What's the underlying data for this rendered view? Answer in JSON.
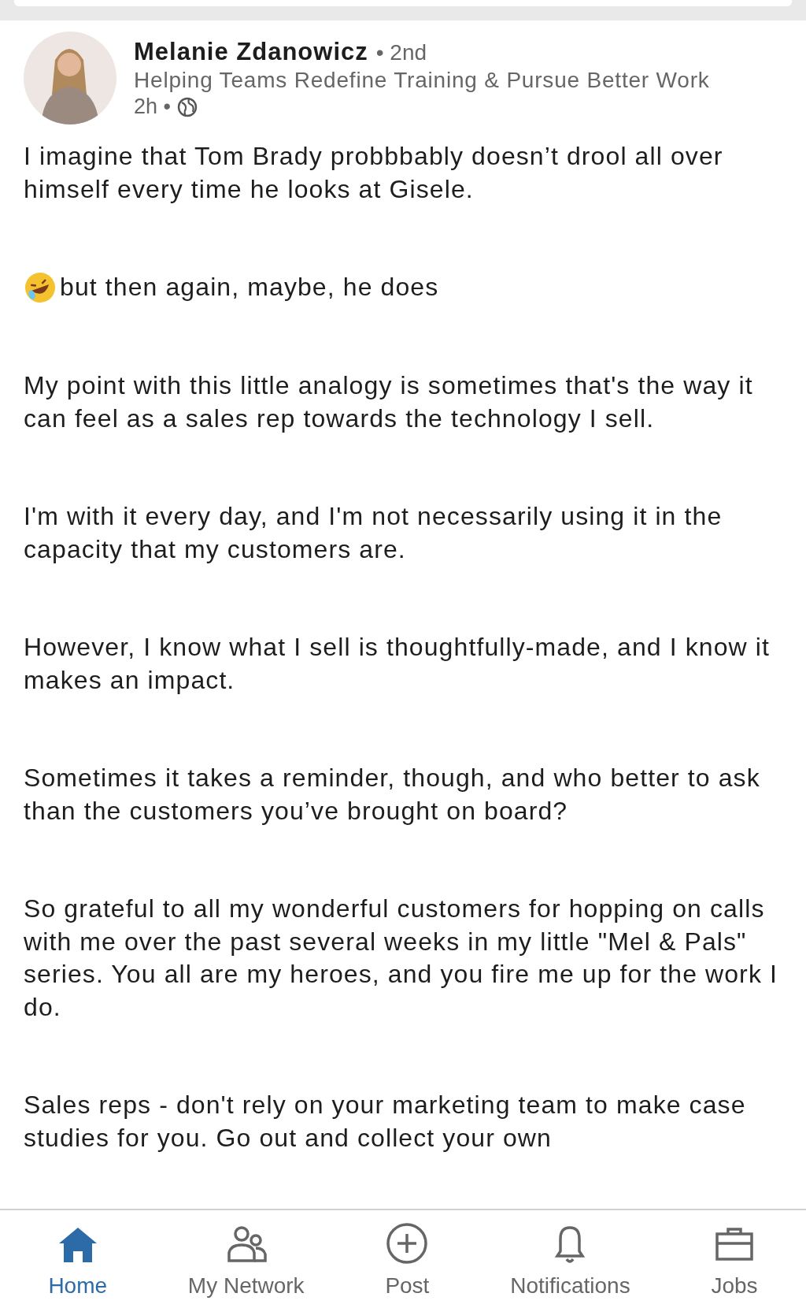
{
  "author": {
    "name": "Melanie Zdanowicz",
    "degree": "• 2nd",
    "headline": "Helping Teams Redefine Training & Pursue Better Work",
    "time": "2h •"
  },
  "post": {
    "paragraphs": [
      {
        "text": "I imagine that Tom Brady probbbably doesn’t drool all over himself every time he looks at Gisele."
      },
      {
        "text": "but then again, maybe, he does",
        "emoji": true
      },
      {
        "text": "My point with this little analogy is sometimes that's the way it can feel as a sales rep towards the technology I sell."
      },
      {
        "text": "I'm with it every day, and I'm not necessarily using it in the capacity that my customers are."
      },
      {
        "text": "However, I know what I sell is thoughtfully-made, and I know it makes an impact."
      },
      {
        "text": "Sometimes it takes a reminder, though, and who better to ask than the customers you’ve brought on board?"
      },
      {
        "text": "So grateful to all my wonderful customers for hopping on calls with me over the past several weeks in my little \"Mel & Pals\" series. You all are my heroes, and you fire me up for the work I do."
      },
      {
        "text": "Sales reps - don't rely on your marketing team to make case studies for you. Go out and collect your own"
      }
    ]
  },
  "tab_bar": [
    {
      "label": "Home",
      "kind": "home",
      "selected": true
    },
    {
      "label": "My Network",
      "kind": "network",
      "selected": false
    },
    {
      "label": "Post",
      "kind": "post",
      "selected": false
    },
    {
      "label": "Notifications",
      "kind": "bell",
      "selected": false
    },
    {
      "label": "Jobs",
      "kind": "jobs",
      "selected": false
    }
  ]
}
